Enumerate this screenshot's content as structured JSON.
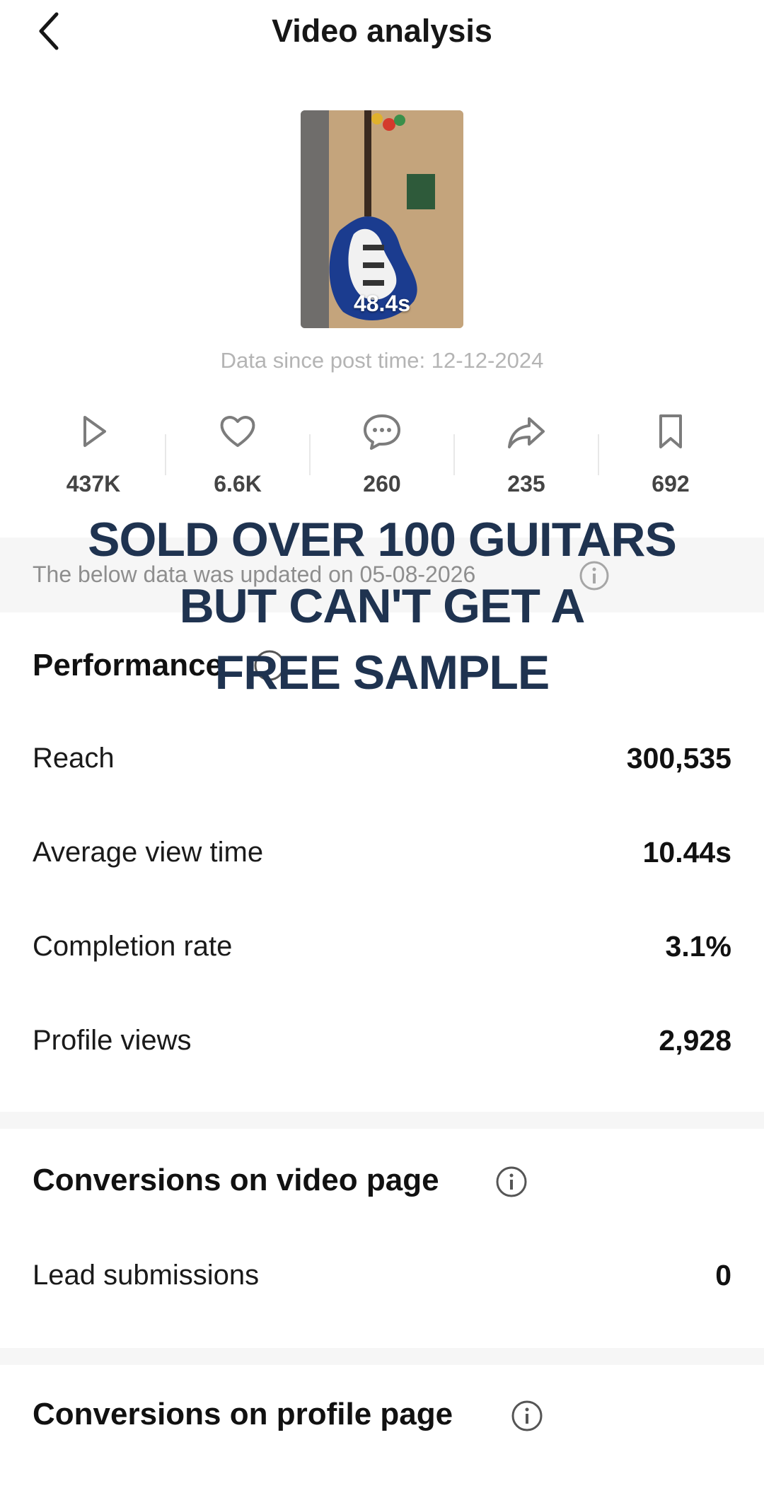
{
  "header": {
    "title": "Video analysis"
  },
  "video": {
    "duration": "48.4s",
    "since_label": "Data since post time: 12-12-2024"
  },
  "stats": [
    {
      "icon": "play-icon",
      "value": "437K"
    },
    {
      "icon": "heart-icon",
      "value": "6.6K"
    },
    {
      "icon": "comment-icon",
      "value": "260"
    },
    {
      "icon": "share-icon",
      "value": "235"
    },
    {
      "icon": "bookmark-icon",
      "value": "692"
    }
  ],
  "update_note": "The below data was updated on 05-08-2026",
  "performance": {
    "title": "Performance",
    "rows": [
      {
        "label": "Reach",
        "value": "300,535"
      },
      {
        "label": "Average view time",
        "value": "10.44s"
      },
      {
        "label": "Completion rate",
        "value": "3.1%"
      },
      {
        "label": "Profile views",
        "value": "2,928"
      }
    ]
  },
  "conversions_video": {
    "title": "Conversions on video page",
    "rows": [
      {
        "label": "Lead submissions",
        "value": "0"
      }
    ]
  },
  "conversions_profile": {
    "title": "Conversions on profile page"
  },
  "overlay_caption": [
    "SOLD OVER 100 GUITARS",
    "BUT CAN'T GET A",
    "FREE SAMPLE"
  ],
  "colors": {
    "overlay_text": "#1f3350",
    "muted": "#b4b4b4",
    "icon_gray": "#7c7c7c"
  }
}
